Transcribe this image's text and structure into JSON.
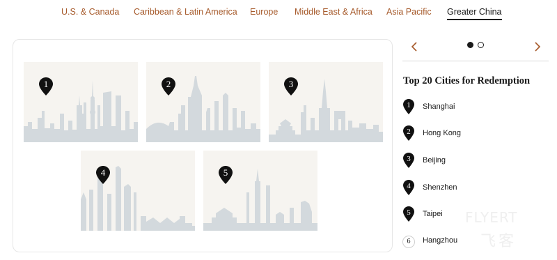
{
  "tabs": [
    {
      "label": "U.S. & Canada"
    },
    {
      "label": "Caribbean & Latin America"
    },
    {
      "label": "Europe"
    },
    {
      "label": "Middle East & Africa"
    },
    {
      "label": "Asia Pacific"
    },
    {
      "label": "Greater China",
      "active": true
    }
  ],
  "colors": {
    "accent": "#a65a2b",
    "text": "#1a1a1a",
    "skyline": "#d3d9dd",
    "card_bg": "#f6f4f0"
  },
  "skylines": [
    {
      "number": "1",
      "city": "Shanghai"
    },
    {
      "number": "2",
      "city": "Hong Kong"
    },
    {
      "number": "3",
      "city": "Beijing"
    },
    {
      "number": "4",
      "city": "Shenzhen"
    },
    {
      "number": "5",
      "city": "Taipei"
    }
  ],
  "carousel": {
    "pages": 2,
    "current": 1,
    "prev_icon": "chevron-left-icon",
    "next_icon": "chevron-right-icon"
  },
  "panel": {
    "title": "Top 20 Cities for Redemption",
    "cities": [
      {
        "rank": "1",
        "name": "Shanghai"
      },
      {
        "rank": "2",
        "name": "Hong Kong"
      },
      {
        "rank": "3",
        "name": "Beijing"
      },
      {
        "rank": "4",
        "name": "Shenzhen"
      },
      {
        "rank": "5",
        "name": "Taipei"
      },
      {
        "rank": "6",
        "name": "Hangzhou"
      }
    ]
  },
  "watermark": {
    "latin": "FLYERT",
    "cjk": "飞客"
  }
}
